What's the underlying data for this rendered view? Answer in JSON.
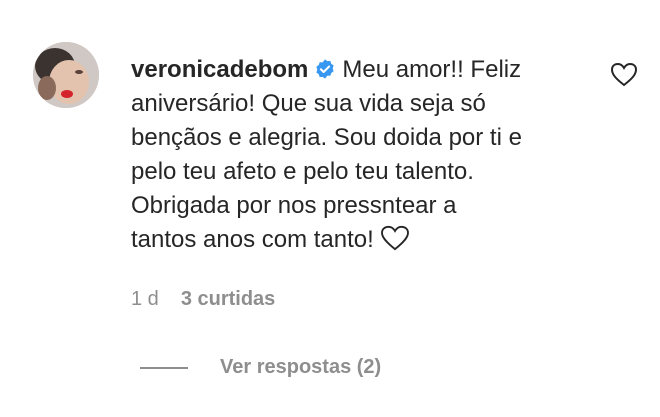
{
  "comment": {
    "username": "veronicadebom",
    "text_lines": [
      "Meu amor!! Feliz",
      "aniversário! Que sua vida seja só",
      "bençãos e alegria. Sou doida por ti e",
      "pelo teu afeto e pelo teu talento.",
      "Obrigada por nos pressntear a",
      "tantos anos com tanto!"
    ],
    "age": "1 d",
    "likes": "3 curtidas",
    "view_replies": "Ver respostas (2)"
  },
  "icons": {
    "verified": "verified-badge-icon",
    "like": "heart-outline-icon",
    "emoji": "white-heart-emoji"
  },
  "colors": {
    "verified_blue": "#3897f0",
    "secondary_text": "#8e8e8e",
    "primary_text": "#262626"
  }
}
